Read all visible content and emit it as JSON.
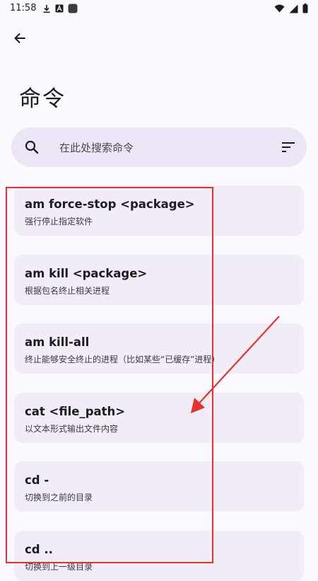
{
  "status_bar": {
    "time": "11:58",
    "left_icons": [
      "download-icon",
      "app-a-icon",
      "app-square-icon"
    ],
    "right_icons": [
      "wifi-icon",
      "signal-icon",
      "battery-icon"
    ]
  },
  "header": {
    "back_icon": "arrow-left-icon",
    "title": "命令"
  },
  "search": {
    "placeholder": "在此处搜索命令",
    "search_icon": "search-icon",
    "sort_icon": "sort-icon"
  },
  "commands": [
    {
      "name": "am force-stop <package>",
      "desc": "强行停止指定软件"
    },
    {
      "name": "am kill <package>",
      "desc": "根据包名终止相关进程"
    },
    {
      "name": "am kill-all",
      "desc": "终止能够安全终止的进程（比如某些“已缓存”进程）"
    },
    {
      "name": "cat <file_path>",
      "desc": "以文本形式输出文件内容"
    },
    {
      "name": "cd -",
      "desc": "切换到之前的目录"
    },
    {
      "name": "cd ..",
      "desc": "切换到上一级目录"
    }
  ],
  "colors": {
    "background": "#fcf8ff",
    "card": "#f1ecf6",
    "search_bg": "#ebe5f5",
    "annotation_red": "#e8302c"
  }
}
